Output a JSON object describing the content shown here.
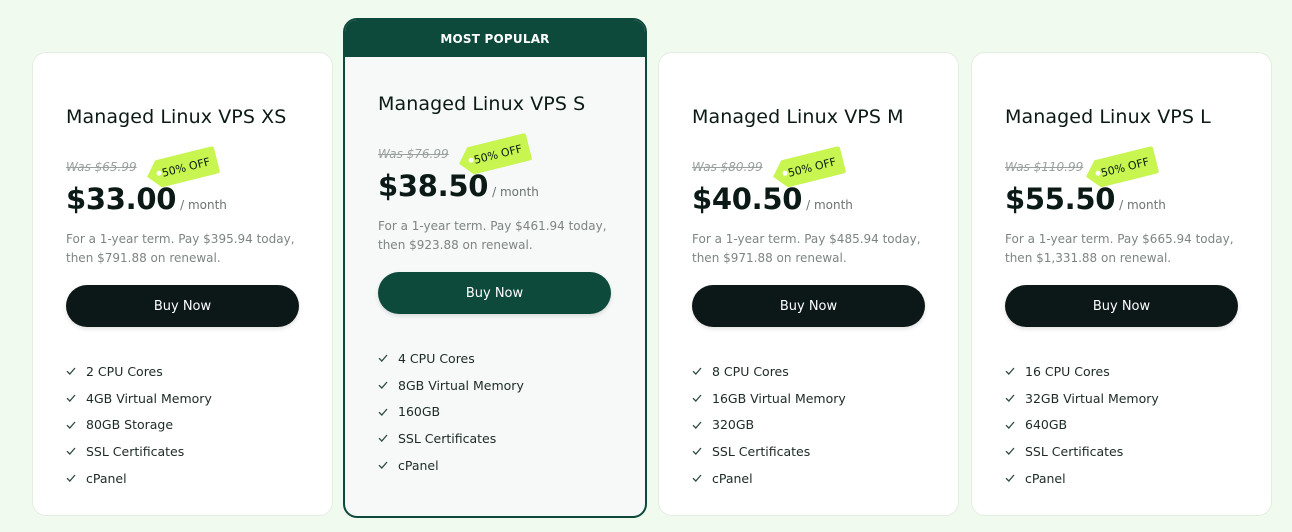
{
  "colors": {
    "page_bg": "#f1faee",
    "card_bg": "#ffffff",
    "featured_bg": "#f6f9f8",
    "accent_dark_green": "#0e4a3c",
    "button_dark": "#0c1817",
    "discount_tag": "#c8f54f",
    "muted_text": "#7d8582"
  },
  "plans": [
    {
      "title": "Managed Linux VPS XS",
      "was_price": "Was $65.99",
      "discount": "50% OFF",
      "price": "$33.00",
      "period": "/ month",
      "terms": "For a 1-year term. Pay $395.94 today, then $791.88 on renewal.",
      "button": "Buy Now",
      "features": [
        "2 CPU Cores",
        "4GB Virtual Memory",
        "80GB Storage",
        "SSL Certificates",
        "cPanel"
      ]
    },
    {
      "badge": "MOST POPULAR",
      "title": "Managed Linux VPS S",
      "was_price": "Was $76.99",
      "discount": "50% OFF",
      "price": "$38.50",
      "period": "/ month",
      "terms": "For a 1-year term. Pay $461.94 today, then $923.88 on renewal.",
      "button": "Buy Now",
      "features": [
        "4 CPU Cores",
        "8GB Virtual Memory",
        "160GB",
        "SSL Certificates",
        "cPanel"
      ]
    },
    {
      "title": "Managed Linux VPS M",
      "was_price": "Was $80.99",
      "discount": "50% OFF",
      "price": "$40.50",
      "period": "/ month",
      "terms": "For a 1-year term. Pay $485.94 today, then $971.88 on renewal.",
      "button": "Buy Now",
      "features": [
        "8 CPU Cores",
        "16GB Virtual Memory",
        "320GB",
        "SSL Certificates",
        "cPanel"
      ]
    },
    {
      "title": "Managed Linux VPS L",
      "was_price": "Was $110.99",
      "discount": "50% OFF",
      "price": "$55.50",
      "period": "/ month",
      "terms": "For a 1-year term. Pay $665.94 today, then $1,331.88 on renewal.",
      "button": "Buy Now",
      "features": [
        "16 CPU Cores",
        "32GB Virtual Memory",
        "640GB",
        "SSL Certificates",
        "cPanel"
      ]
    }
  ]
}
